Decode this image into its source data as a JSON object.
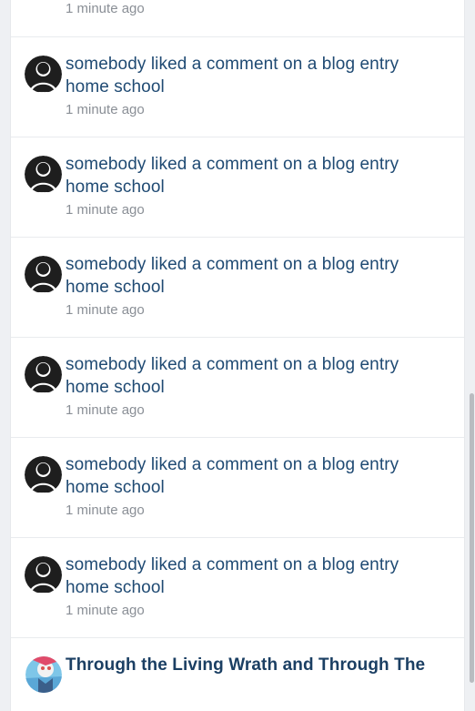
{
  "activity": {
    "top_item": {
      "time": "1 minute ago"
    },
    "items": [
      {
        "action": "somebody liked a comment on a blog entry home school",
        "time": "1 minute ago",
        "avatar_icon": "default-user-avatar-icon"
      },
      {
        "action": "somebody liked a comment on a blog entry home school",
        "time": "1 minute ago",
        "avatar_icon": "default-user-avatar-icon"
      },
      {
        "action": "somebody liked a comment on a blog entry home school",
        "time": "1 minute ago",
        "avatar_icon": "default-user-avatar-icon"
      },
      {
        "action": "somebody liked a comment on a blog entry home school",
        "time": "1 minute ago",
        "avatar_icon": "default-user-avatar-icon"
      },
      {
        "action": "somebody liked a comment on a blog entry home school",
        "time": "1 minute ago",
        "avatar_icon": "default-user-avatar-icon"
      },
      {
        "action": "somebody liked a comment on a blog entry home school",
        "time": "1 minute ago",
        "avatar_icon": "default-user-avatar-icon"
      }
    ],
    "last_item": {
      "title": "Through the Living Wrath and Through The",
      "avatar_icon": "user-photo-avatar-icon"
    }
  },
  "colors": {
    "link": "#1f4a73",
    "muted": "#8a8f96",
    "background": "#eef0f3",
    "card": "#ffffff",
    "scrollbar": "#b9bcc0"
  }
}
